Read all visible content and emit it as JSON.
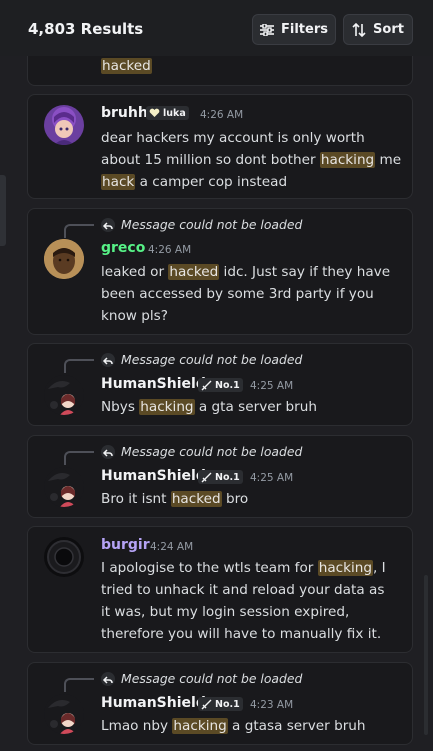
{
  "header": {
    "results_count": "4,803 Results",
    "filters_label": "Filters",
    "sort_label": "Sort"
  },
  "reply_placeholder": "Message could not be loaded",
  "results": [
    {
      "partial_text": "hacked"
    },
    {
      "username": "bruhh",
      "tag": "luka",
      "timestamp": "4:26 AM",
      "name_color": "#f2f3f5",
      "lines": [
        [
          "dear hackers my account is only worth"
        ],
        [
          "about 15 million so dont bother ",
          "hacking",
          " me"
        ],
        [
          "",
          "hack",
          " a camper cop instead"
        ]
      ]
    },
    {
      "username": "greco",
      "timestamp": "4:26 AM",
      "name_color": "#57f287",
      "lines": [
        [
          "leaked or ",
          "hacked",
          " idc. Just say if they have"
        ],
        [
          "been accessed by some 3rd party if you"
        ],
        [
          "know pls?"
        ]
      ]
    },
    {
      "username": "HumanShield",
      "tag": "No.1",
      "timestamp": "4:25 AM",
      "name_color": "#f2f3f5",
      "lines": [
        [
          "Nbys ",
          "hacking",
          " a gta server bruh"
        ]
      ]
    },
    {
      "username": "HumanShield",
      "tag": "No.1",
      "timestamp": "4:25 AM",
      "name_color": "#f2f3f5",
      "lines": [
        [
          "Bro it isnt ",
          "hacked",
          " bro"
        ]
      ]
    },
    {
      "username": "burgir",
      "timestamp": "4:24 AM",
      "name_color": "#b5a3f5",
      "lines": [
        [
          "I apologise to the wtls team for ",
          "hacking",
          ", I"
        ],
        [
          "tried to unhack it and reload your data as"
        ],
        [
          "it was, but my login session expired,"
        ],
        [
          "therefore you will have to manually fix it."
        ]
      ]
    },
    {
      "username": "HumanShield",
      "tag": "No.1",
      "timestamp": "4:23 AM",
      "name_color": "#f2f3f5",
      "lines": [
        [
          "Lmao nby ",
          "hacking",
          " a gtasa server bruh"
        ]
      ]
    }
  ]
}
